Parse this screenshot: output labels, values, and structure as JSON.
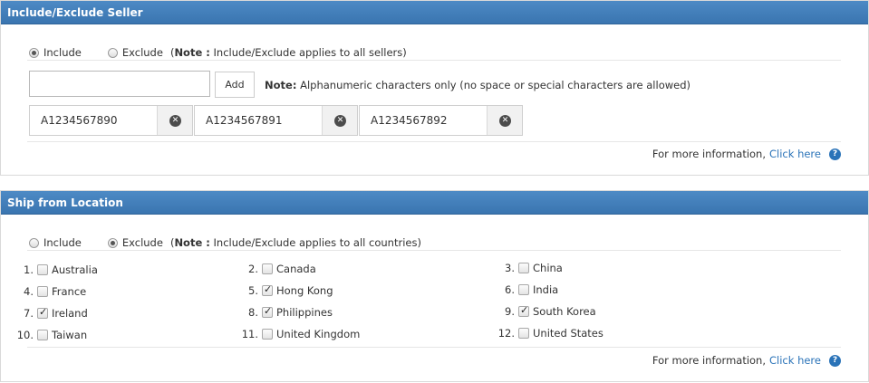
{
  "seller": {
    "title": "Include/Exclude Seller",
    "include_label": "Include",
    "exclude_label": "Exclude",
    "selected": "include",
    "note_paren_open": "(",
    "note_bold": "Note :",
    "note_text": "Include/Exclude applies to all sellers)",
    "input_value": "",
    "add_label": "Add",
    "alnum_note_bold": "Note:",
    "alnum_note_text": "Alphanumeric characters only (no space or special characters are allowed)",
    "tags": [
      "A1234567890",
      "A1234567891",
      "A1234567892"
    ],
    "more_info_text": "For more information,",
    "more_info_link": "Click here"
  },
  "ship": {
    "title": "Ship from Location",
    "include_label": "Include",
    "exclude_label": "Exclude",
    "selected": "exclude",
    "note_paren_open": "(",
    "note_bold": "Note :",
    "note_text": "Include/Exclude applies to all countries)",
    "countries": [
      {
        "num": "1.",
        "name": "Australia",
        "checked": false
      },
      {
        "num": "2.",
        "name": "Canada",
        "checked": false
      },
      {
        "num": "3.",
        "name": "China",
        "checked": false
      },
      {
        "num": "4.",
        "name": "France",
        "checked": false
      },
      {
        "num": "5.",
        "name": "Hong Kong",
        "checked": true
      },
      {
        "num": "6.",
        "name": "India",
        "checked": false
      },
      {
        "num": "7.",
        "name": "Ireland",
        "checked": true
      },
      {
        "num": "8.",
        "name": "Philippines",
        "checked": true
      },
      {
        "num": "9.",
        "name": "South Korea",
        "checked": true
      },
      {
        "num": "10.",
        "name": "Taiwan",
        "checked": false
      },
      {
        "num": "11.",
        "name": "United Kingdom",
        "checked": false
      },
      {
        "num": "12.",
        "name": "United States",
        "checked": false
      }
    ],
    "more_info_text": "For more information,",
    "more_info_link": "Click here"
  },
  "icons": {
    "remove": "close-circle-icon",
    "help": "question-circle-icon"
  }
}
